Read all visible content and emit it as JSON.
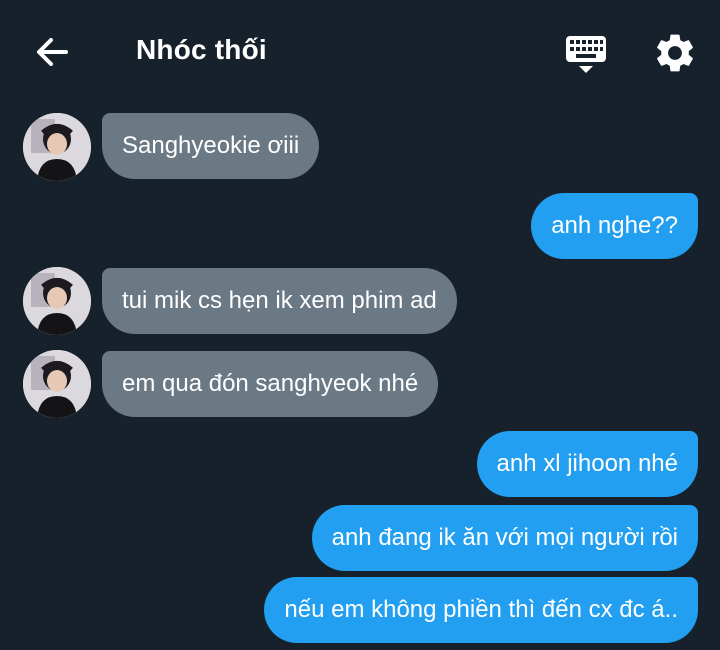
{
  "header": {
    "title": "Nhóc thối",
    "back_icon": "arrow-left-icon",
    "keyboard_icon": "keyboard-icon",
    "settings_icon": "gear-icon"
  },
  "colors": {
    "background": "#17212b",
    "incoming_bubble": "#6b7985",
    "outgoing_bubble": "#229ff0",
    "text": "#ffffff"
  },
  "messages": [
    {
      "direction": "incoming",
      "text": "Sanghyeokie ơiii"
    },
    {
      "direction": "outgoing",
      "text": "anh nghe??"
    },
    {
      "direction": "incoming",
      "text": "tui mik cs hẹn ik xem phim ad"
    },
    {
      "direction": "incoming",
      "text": "em qua đón sanghyeok nhé"
    },
    {
      "direction": "outgoing",
      "text": "anh xl jihoon nhé"
    },
    {
      "direction": "outgoing",
      "text": "anh đang ik ăn với mọi người rồi"
    },
    {
      "direction": "outgoing",
      "text": "nếu em không phiền thì đến cx đc á.."
    }
  ]
}
